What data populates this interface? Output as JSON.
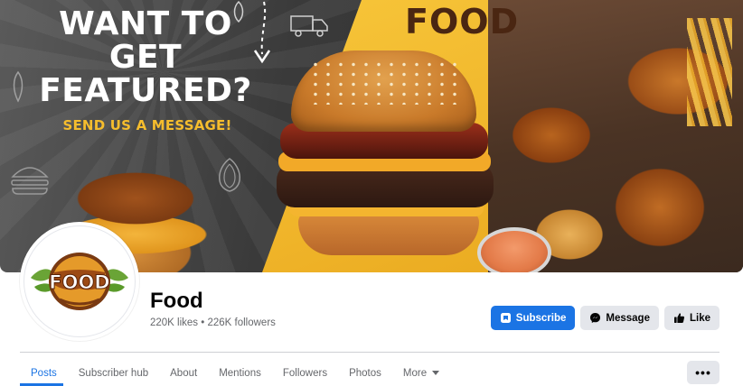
{
  "cover": {
    "headline": "WANT TO GET FEATURED?",
    "subline": "SEND US A MESSAGE!",
    "brand_text": "FOOD"
  },
  "profile": {
    "logo_text": "FOOD",
    "name": "Food",
    "stats": "220K likes • 226K followers"
  },
  "actions": {
    "subscribe_label": "Subscribe",
    "message_label": "Message",
    "like_label": "Like"
  },
  "tabs": [
    {
      "label": "Posts",
      "active": true
    },
    {
      "label": "Subscriber hub"
    },
    {
      "label": "About"
    },
    {
      "label": "Mentions"
    },
    {
      "label": "Followers"
    },
    {
      "label": "Photos"
    },
    {
      "label": "More"
    }
  ],
  "more_menu_label": "•••",
  "colors": {
    "accent": "#1b74e4",
    "cover_yellow": "#f2b52c",
    "cover_gray": "#3a3a3a",
    "logo_brown": "#7a3a12",
    "logo_green": "#5a9a2a"
  },
  "icons": [
    "arrow-doodle-icon",
    "delivery-truck-icon",
    "burger-doodle-icon",
    "onion-doodle-icon",
    "subscribe-icon",
    "messenger-icon",
    "thumbs-up-icon",
    "caret-down-icon"
  ]
}
